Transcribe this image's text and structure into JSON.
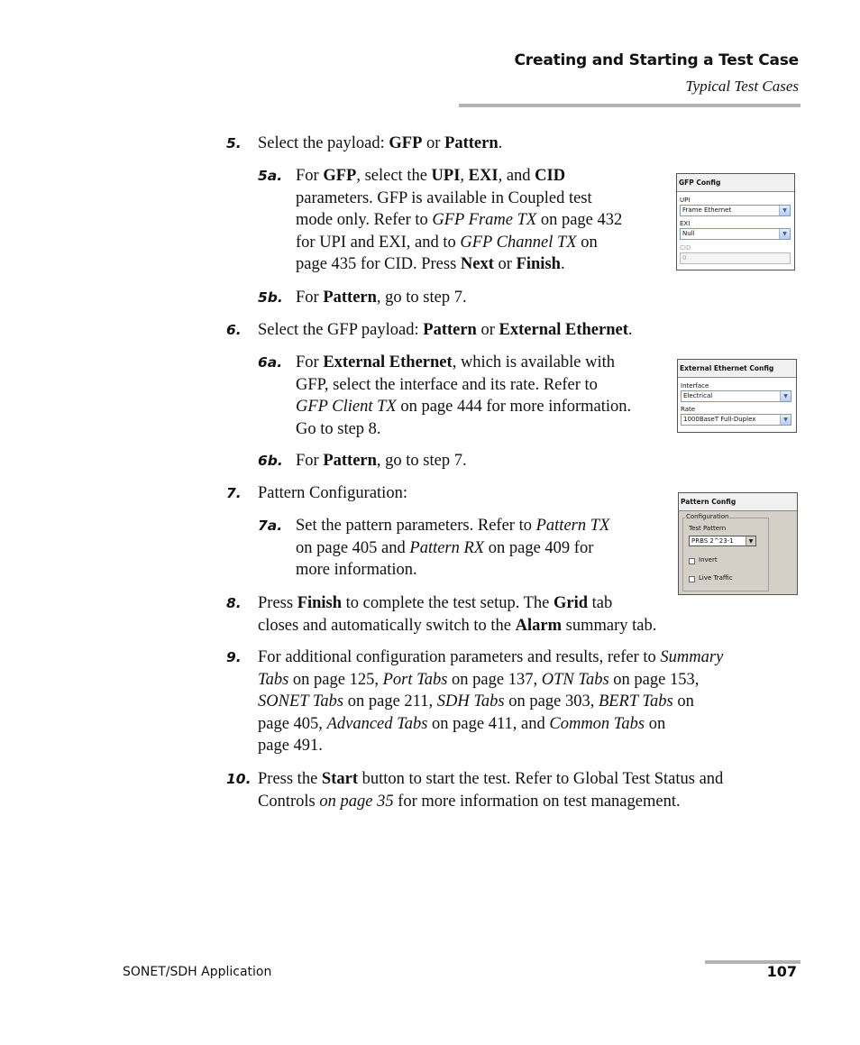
{
  "header": {
    "title": "Creating and Starting a Test Case",
    "subtitle": "Typical Test Cases"
  },
  "steps": {
    "s5": {
      "num": "5.",
      "parts": [
        "Select the payload: ",
        "GFP",
        " or ",
        "Pattern",
        "."
      ]
    },
    "s5a": {
      "num": "5a.",
      "lines": [
        [
          "For ",
          "GFP",
          ", select the ",
          "UPI",
          ", ",
          "EXI",
          ", and ",
          "CID"
        ],
        [
          "parameters. GFP is available in Coupled test"
        ],
        [
          "mode only. Refer to ",
          "GFP Frame TX",
          " on page 432"
        ],
        [
          "for UPI and EXI, and to ",
          "GFP Channel TX",
          " on"
        ],
        [
          "page 435 for CID. Press ",
          "Next",
          " or ",
          "Finish",
          "."
        ]
      ]
    },
    "s5b": {
      "num": "5b.",
      "parts": [
        "For ",
        "Pattern",
        ", go to step 7."
      ]
    },
    "s6": {
      "num": "6.",
      "parts": [
        "Select the GFP payload: ",
        "Pattern",
        " or ",
        "External Ethernet",
        "."
      ]
    },
    "s6a": {
      "num": "6a.",
      "lines": [
        [
          "For ",
          "External Ethernet",
          ", which is available with"
        ],
        [
          "GFP, select the interface and its rate. Refer to"
        ],
        [
          "GFP Client TX",
          " on page 444 for more information."
        ],
        [
          "Go to step 8."
        ]
      ]
    },
    "s6b": {
      "num": "6b.",
      "parts": [
        "For ",
        "Pattern",
        ", go to step 7."
      ]
    },
    "s7": {
      "num": "7.",
      "text": "Pattern Configuration:"
    },
    "s7a": {
      "num": "7a.",
      "lines": [
        [
          "Set the pattern parameters. Refer to ",
          "Pattern TX"
        ],
        [
          "on page 405 and ",
          "Pattern RX",
          " on page 409 for"
        ],
        [
          "more information."
        ]
      ]
    },
    "s8": {
      "num": "8.",
      "lines": [
        [
          "Press ",
          "Finish",
          " to complete the test setup. The ",
          "Grid",
          " tab"
        ],
        [
          "closes and automatically switch to the ",
          "Alarm",
          " summary tab."
        ]
      ]
    },
    "s9": {
      "num": "9.",
      "lines": [
        [
          "For additional configuration parameters and results, refer to ",
          "Summary"
        ],
        [
          "Tabs",
          " on page 125, ",
          "Port Tabs",
          " on page 137, ",
          "OTN Tabs",
          " on page 153,"
        ],
        [
          "SONET Tabs",
          " on page 211, ",
          "SDH Tabs",
          " on page 303, ",
          "BERT Tabs",
          " on"
        ],
        [
          "page 405, ",
          "Advanced Tabs",
          " on page 411, and ",
          "Common Tabs",
          " on"
        ],
        [
          "page 491."
        ]
      ]
    },
    "s10": {
      "num": "10.",
      "lines": [
        [
          "Press the ",
          "Start",
          " button to start the test. Refer to Global Test Status and"
        ],
        [
          "Controls ",
          "on page 35",
          " for more information on test management."
        ]
      ]
    }
  },
  "panels": {
    "gfp": {
      "title": "GFP Config",
      "upi_label": "UPI",
      "upi_value": "Frame Ethernet",
      "exi_label": "EXI",
      "exi_value": "Null",
      "cid_label": "CID",
      "cid_value": "0"
    },
    "ext_eth": {
      "title": "External Ethernet Config",
      "interface_label": "Interface",
      "interface_value": "Electrical",
      "rate_label": "Rate",
      "rate_value": "1000BaseT Full-Duplex"
    },
    "pattern": {
      "title": "Pattern Config",
      "group_label": "Configuration",
      "test_pattern_label": "Test Pattern",
      "test_pattern_value": "PRBS 2^23-1",
      "invert_label": "Invert",
      "invert_checked": false,
      "live_traffic_label": "Live Traffic",
      "live_traffic_checked": false
    }
  },
  "footer": {
    "left": "SONET/SDH Application",
    "page": "107"
  }
}
